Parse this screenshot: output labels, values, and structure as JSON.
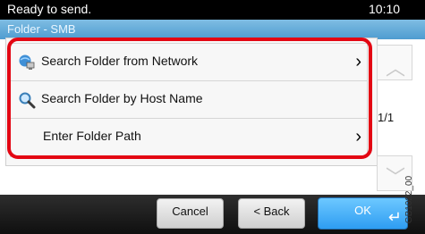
{
  "status": {
    "message": "Ready to send.",
    "time": "10:10"
  },
  "header": {
    "title": "Folder - SMB"
  },
  "menu": {
    "items": [
      {
        "label": "Search Folder from Network",
        "icon": "network-globe-icon",
        "has_chevron": true
      },
      {
        "label": "Search Folder by Host Name",
        "icon": "magnifier-icon",
        "has_chevron": false
      },
      {
        "label": "Enter Folder Path",
        "icon": "",
        "has_chevron": true
      }
    ]
  },
  "pagination": {
    "page": "1/1"
  },
  "footer": {
    "cancel_label": "Cancel",
    "back_label": "< Back",
    "ok_label": "OK"
  },
  "side_label": "GB1022_00",
  "colors": {
    "highlight_frame": "#e30613",
    "ok_button": "#2e9df2",
    "title_bar": "#5aa6d6"
  }
}
